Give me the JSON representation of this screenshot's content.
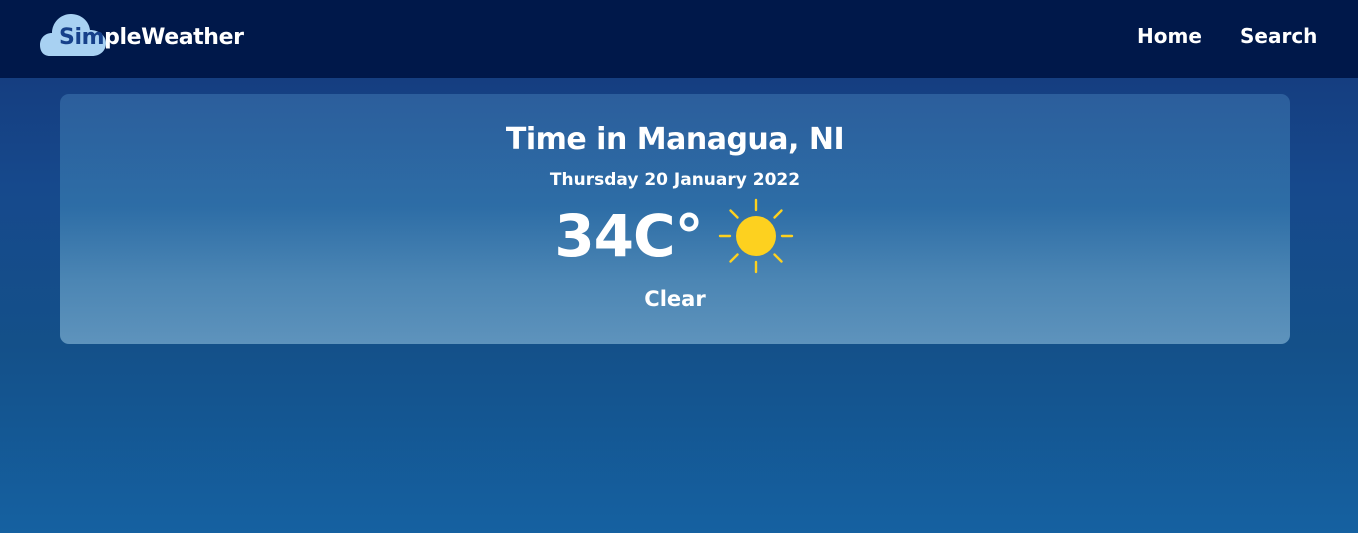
{
  "brand": {
    "part_1": "Sim",
    "part_2": "pleWeather"
  },
  "nav": {
    "home": "Home",
    "search": "Search"
  },
  "weather": {
    "title": "Time in Managua, NI",
    "date": "Thursday 20 January 2022",
    "temperature": "34C°",
    "condition": "Clear",
    "icon": "sun-icon"
  },
  "colors": {
    "navbar": "#00184a",
    "logo_cloud": "#a8d1f2",
    "logo_accent": "#16408a",
    "sun": "#fdd11f"
  }
}
